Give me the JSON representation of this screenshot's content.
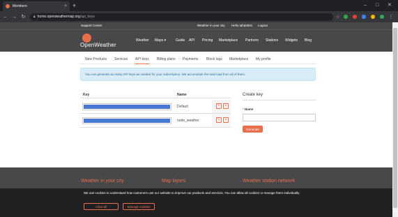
{
  "browser": {
    "tab_title": "Members",
    "tab_close": "×",
    "new_tab": "+",
    "url_host": "home.openweathermap.org",
    "url_path": "/api_keys",
    "window_controls": [
      "–",
      "□",
      "✕"
    ],
    "ext_colors": [
      "#34a853",
      "#ea4335",
      "#4285f4",
      "#fbbc05",
      "#34a853"
    ]
  },
  "topstrip": {
    "support": "Support Center",
    "search_hint": "Weather in your city",
    "greeting": "Hello taha2601",
    "logout": "Logout"
  },
  "header": {
    "logo_text": "OpenWeather",
    "nav": [
      "Weather",
      "Maps ▾",
      "Guide",
      "API",
      "Pricing",
      "Marketplace",
      "Partners",
      "Stations",
      "Widgets",
      "Blog"
    ]
  },
  "tabs": [
    "New Products",
    "Services",
    "API keys",
    "Billing plans",
    "Payments",
    "Block logs",
    "Marketplace",
    "My profile"
  ],
  "active_tab": "API keys",
  "info_text": "You can generate as many API keys as needed for your subscription. We accumulate the total load from all of them.",
  "keys_table": {
    "headers": {
      "key": "Key",
      "name": "Name"
    },
    "rows": [
      {
        "name": "Default"
      },
      {
        "name": "node_weather"
      }
    ]
  },
  "create_key": {
    "title": "Create key",
    "name_label": "Name",
    "required_mark": "*",
    "name_value": "",
    "generate_label": "Generate"
  },
  "footer": {
    "headings": [
      "Weather in your city",
      "Map layers",
      "Weather station network"
    ]
  },
  "cookie": {
    "text": "We use cookies to understand how customers use our website to improve our products and services. You can allow all cookies or manage them individually.",
    "allow_label": "Allow all",
    "manage_label": "Manage cookies"
  },
  "colors": {
    "brand": "#e96e4c",
    "header_bg": "#48484a",
    "key_mask": "#4a77d4"
  }
}
